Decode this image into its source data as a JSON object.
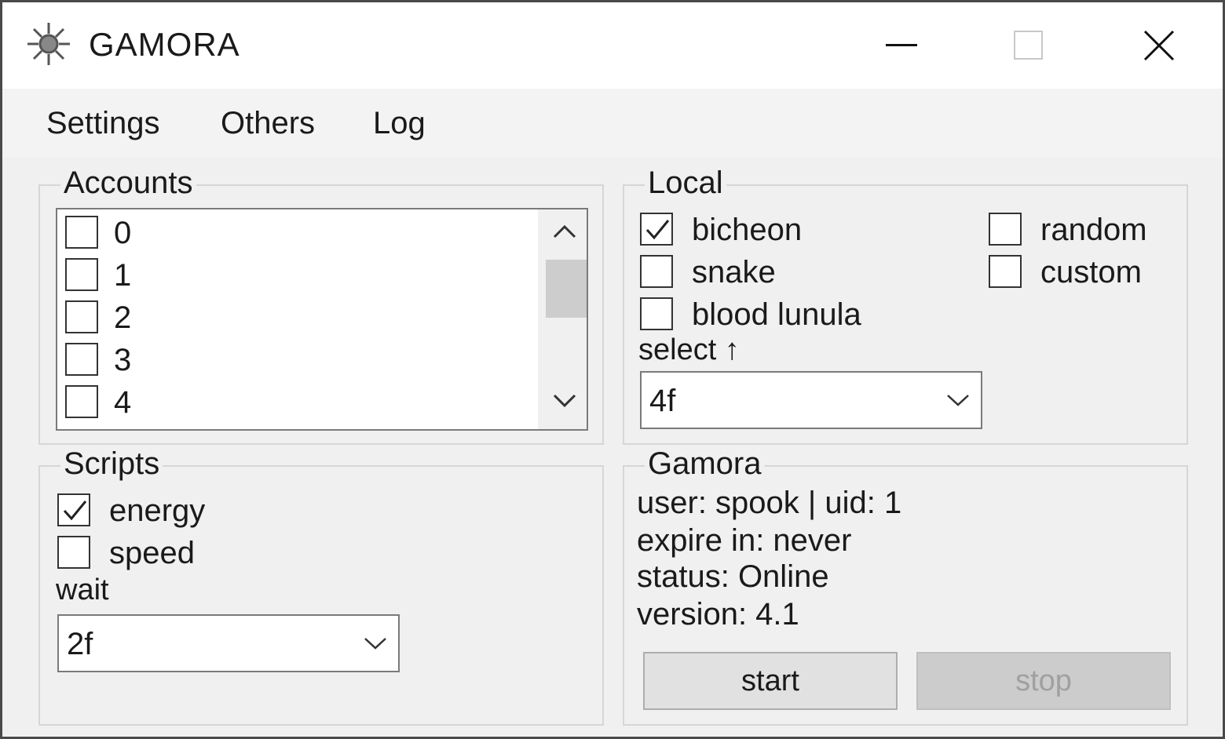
{
  "window": {
    "title": "GAMORA",
    "icon": "virus-icon"
  },
  "menu": [
    "Settings",
    "Others",
    "Log"
  ],
  "accounts": {
    "legend": "Accounts",
    "items": [
      {
        "label": "0",
        "checked": false
      },
      {
        "label": "1",
        "checked": false
      },
      {
        "label": "2",
        "checked": false
      },
      {
        "label": "3",
        "checked": false
      },
      {
        "label": "4",
        "checked": false
      }
    ]
  },
  "local": {
    "legend": "Local",
    "options": [
      {
        "label": "bicheon",
        "checked": true
      },
      {
        "label": "snake",
        "checked": false
      },
      {
        "label": "blood lunula",
        "checked": false
      },
      {
        "label": "random",
        "checked": false
      },
      {
        "label": "custom",
        "checked": false
      }
    ],
    "select_label": "select ↑",
    "select_value": "4f"
  },
  "scripts": {
    "legend": "Scripts",
    "options": [
      {
        "label": "energy",
        "checked": true
      },
      {
        "label": "speed",
        "checked": false
      }
    ],
    "wait_label": "wait",
    "wait_value": "2f"
  },
  "gamora": {
    "legend": "Gamora",
    "user_line": "user: spook | uid: 1",
    "expire_line": "expire in: never",
    "status_line": "status: Online",
    "version_line": "version: 4.1",
    "start_label": "start",
    "stop_label": "stop"
  }
}
